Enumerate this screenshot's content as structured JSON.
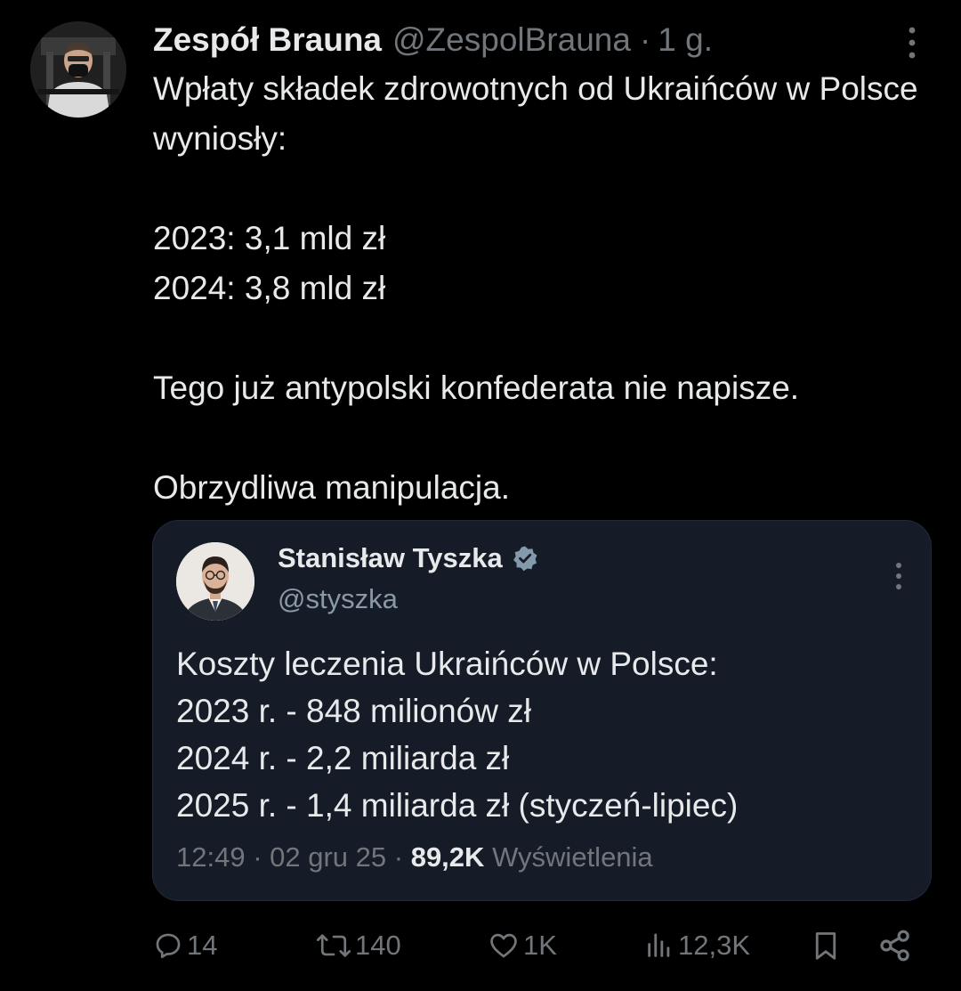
{
  "post": {
    "author_name": "Zespół Brauna",
    "author_handle": "@ZespolBrauna",
    "separator": "·",
    "time": "1 g.",
    "paragraphs": [
      "Wpłaty składek zdrowotnych od Ukraińców w Polsce wyniosły:",
      "",
      "2023: 3,1 mld zł",
      "2024: 3,8 mld zł",
      "",
      "Tego już antypolski konfederata nie napisze.",
      "",
      "Obrzydliwa manipulacja."
    ]
  },
  "quote": {
    "author_name": "Stanisław Tyszka",
    "author_handle": "@styszka",
    "verified": true,
    "lines": [
      "Koszty leczenia Ukraińców w Polsce:",
      "2023 r. - 848 milionów zł",
      "2024 r. - 2,2 miliarda zł",
      "2025 r. - 1,4 miliarda zł (styczeń-lipiec)"
    ],
    "time": "12:49",
    "date": "02 gru 25",
    "views_count": "89,2K",
    "views_label": "Wyświetlenia"
  },
  "actions": {
    "replies": "14",
    "reposts": "140",
    "likes": "1K",
    "views": "12,3K"
  },
  "icons": {
    "post_more": "more-vertical-icon",
    "quote_more": "more-vertical-icon",
    "verified": "verified-badge-icon",
    "reply": "reply-icon",
    "repost": "repost-icon",
    "like": "heart-icon",
    "views": "views-icon",
    "bookmark": "bookmark-icon",
    "share": "share-icon"
  },
  "colors": {
    "background": "#000000",
    "text_primary": "#e7e9ea",
    "text_secondary": "#71767b",
    "quote_background": "#151c27",
    "verified_badge": "#829aab"
  }
}
